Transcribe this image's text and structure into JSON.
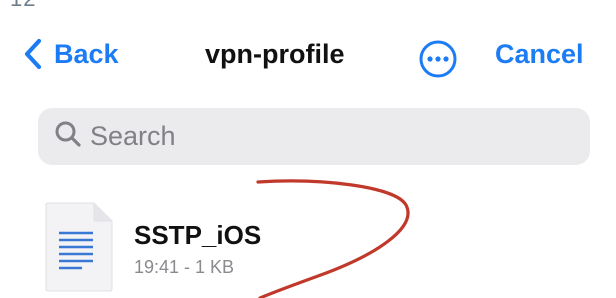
{
  "status_bar": {
    "fragment": "12"
  },
  "nav": {
    "back_label": "Back",
    "title": "vpn-profile",
    "more_icon": "ellipsis-circle-icon",
    "cancel_label": "Cancel"
  },
  "search": {
    "placeholder": "Search",
    "value": ""
  },
  "files": [
    {
      "name": "SSTP_iOS",
      "meta": "19:41 - 1 KB",
      "icon": "document-text-icon"
    }
  ],
  "colors": {
    "accent": "#1c7cf3",
    "annotation": "#c0392b",
    "search_bg": "#ebebee",
    "secondary_text": "#8a8a8f"
  }
}
